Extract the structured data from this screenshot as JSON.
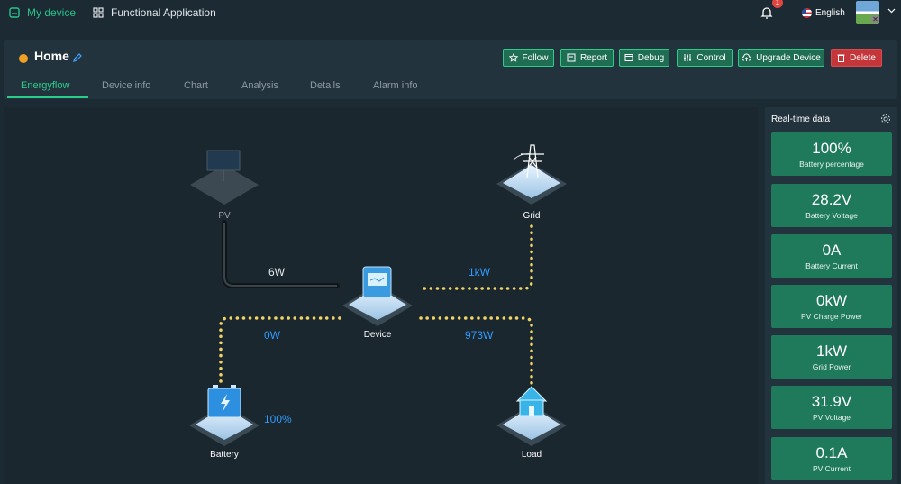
{
  "nav": {
    "my_device": "My device",
    "functional_application": "Functional Application",
    "notification_count": "1",
    "language": "English"
  },
  "header": {
    "title": "Home",
    "status_color": "#f0a023",
    "buttons": {
      "follow": "Follow",
      "report": "Report",
      "debug": "Debug",
      "control": "Control",
      "upgrade": "Upgrade Device",
      "delete": "Delete"
    },
    "tabs": [
      "Energyflow",
      "Device info",
      "Chart",
      "Analysis",
      "Details",
      "Alarm info"
    ],
    "active_tab": "Energyflow"
  },
  "energyflow": {
    "nodes": {
      "pv": "PV",
      "grid": "Grid",
      "device": "Device",
      "battery": "Battery",
      "load": "Load"
    },
    "flows": {
      "pv_power": "6W",
      "grid_power": "1kW",
      "battery_power": "0W",
      "load_power": "973W",
      "battery_soc": "100%"
    }
  },
  "realtime": {
    "title": "Real-time data",
    "cards": [
      {
        "value": "100%",
        "label": "Battery percentage"
      },
      {
        "value": "28.2V",
        "label": "Battery Voltage"
      },
      {
        "value": "0A",
        "label": "Battery Current"
      },
      {
        "value": "0kW",
        "label": "PV Charge Power"
      },
      {
        "value": "1kW",
        "label": "Grid Power"
      },
      {
        "value": "31.9V",
        "label": "PV Voltage"
      },
      {
        "value": "0.1A",
        "label": "PV Current"
      }
    ]
  },
  "colors": {
    "accent": "#2ecc8b",
    "flow_active": "#f2d366",
    "flow_value": "#2f9bff",
    "card_bg": "#1f7a5c",
    "delete": "#c4363a"
  }
}
